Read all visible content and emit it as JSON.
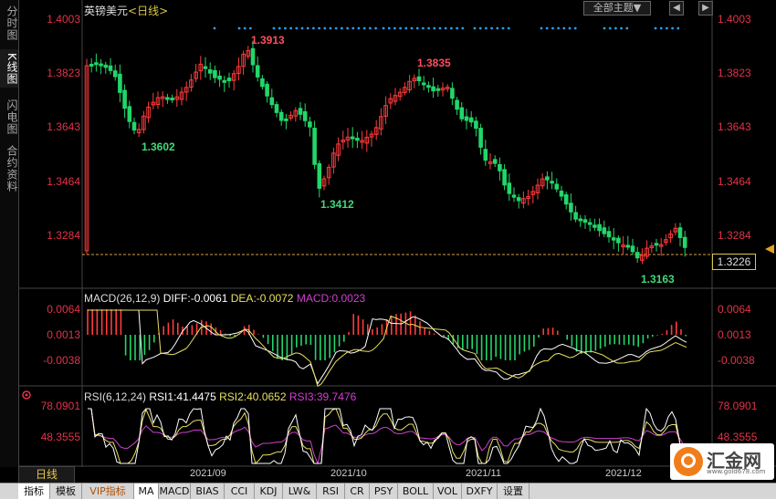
{
  "header": {
    "symbol": "英镑美元",
    "period_open": "<",
    "period": "日线",
    "period_close": ">",
    "theme_selector": "全部主题▼",
    "btn_left": "◀",
    "btn_right": "▶"
  },
  "left_tabs": [
    {
      "label": "分时图",
      "active": false
    },
    {
      "label": "K线图",
      "active": true
    },
    {
      "label": "闪电图",
      "active": false
    },
    {
      "label": "合约资料",
      "active": false
    }
  ],
  "price_axis": {
    "labels": [
      "1.4003",
      "1.3823",
      "1.3643",
      "1.3464",
      "1.3284"
    ],
    "current_price": "1.3226",
    "ylim": [
      1.31,
      1.4003
    ]
  },
  "annotations": {
    "high1": "1.3913",
    "low1": "1.3602",
    "low2": "1.3412",
    "high2": "1.3835",
    "low3": "1.3163"
  },
  "macd": {
    "title": "MACD(26,12,9)",
    "diff": "DIFF:-0.0061",
    "dea": "DEA:-0.0072",
    "macd": "MACD:0.0023",
    "axis_labels": [
      "0.0064",
      "0.0013",
      "-0.0038"
    ]
  },
  "rsi": {
    "title": "RSI(6,12,24)",
    "rsi1": "RSI1:41.4475",
    "rsi2": "RSI2:40.0652",
    "rsi3": "RSI3:39.7476",
    "axis_labels": [
      "78.0901",
      "48.3555"
    ]
  },
  "dates": [
    "2021/09",
    "2021/10",
    "2021/11",
    "2021/12"
  ],
  "period_box": "日线",
  "bottom_tabs": [
    {
      "label": "指标",
      "active": true,
      "vip": false
    },
    {
      "label": "模板",
      "active": false,
      "vip": false
    },
    {
      "label": "VIP指标",
      "active": false,
      "vip": true
    },
    {
      "label": "MA",
      "active": true,
      "vip": false
    },
    {
      "label": "MACD",
      "active": false,
      "vip": false
    },
    {
      "label": "BIAS",
      "active": false,
      "vip": false
    },
    {
      "label": "CCI",
      "active": false,
      "vip": false
    },
    {
      "label": "KDJ",
      "active": false,
      "vip": false
    },
    {
      "label": "LW&",
      "active": false,
      "vip": false
    },
    {
      "label": "RSI",
      "active": false,
      "vip": false
    },
    {
      "label": "CR",
      "active": false,
      "vip": false
    },
    {
      "label": "PSY",
      "active": false,
      "vip": false
    },
    {
      "label": "BOLL",
      "active": false,
      "vip": false
    },
    {
      "label": "VOL",
      "active": false,
      "vip": false
    },
    {
      "label": "DXFY",
      "active": false,
      "vip": false
    },
    {
      "label": "设置",
      "active": false,
      "vip": false
    }
  ],
  "logo": {
    "name": "汇金网",
    "url": "www.gold678.com"
  },
  "colors": {
    "up": "#ff3b3b",
    "down": "#22d66a",
    "diff": "#ffffff",
    "dea": "#e8e060",
    "macd": "#d040d0",
    "axis": "#e0334a",
    "high_label": "#ff4d5e",
    "low_label": "#3fd97a"
  }
}
